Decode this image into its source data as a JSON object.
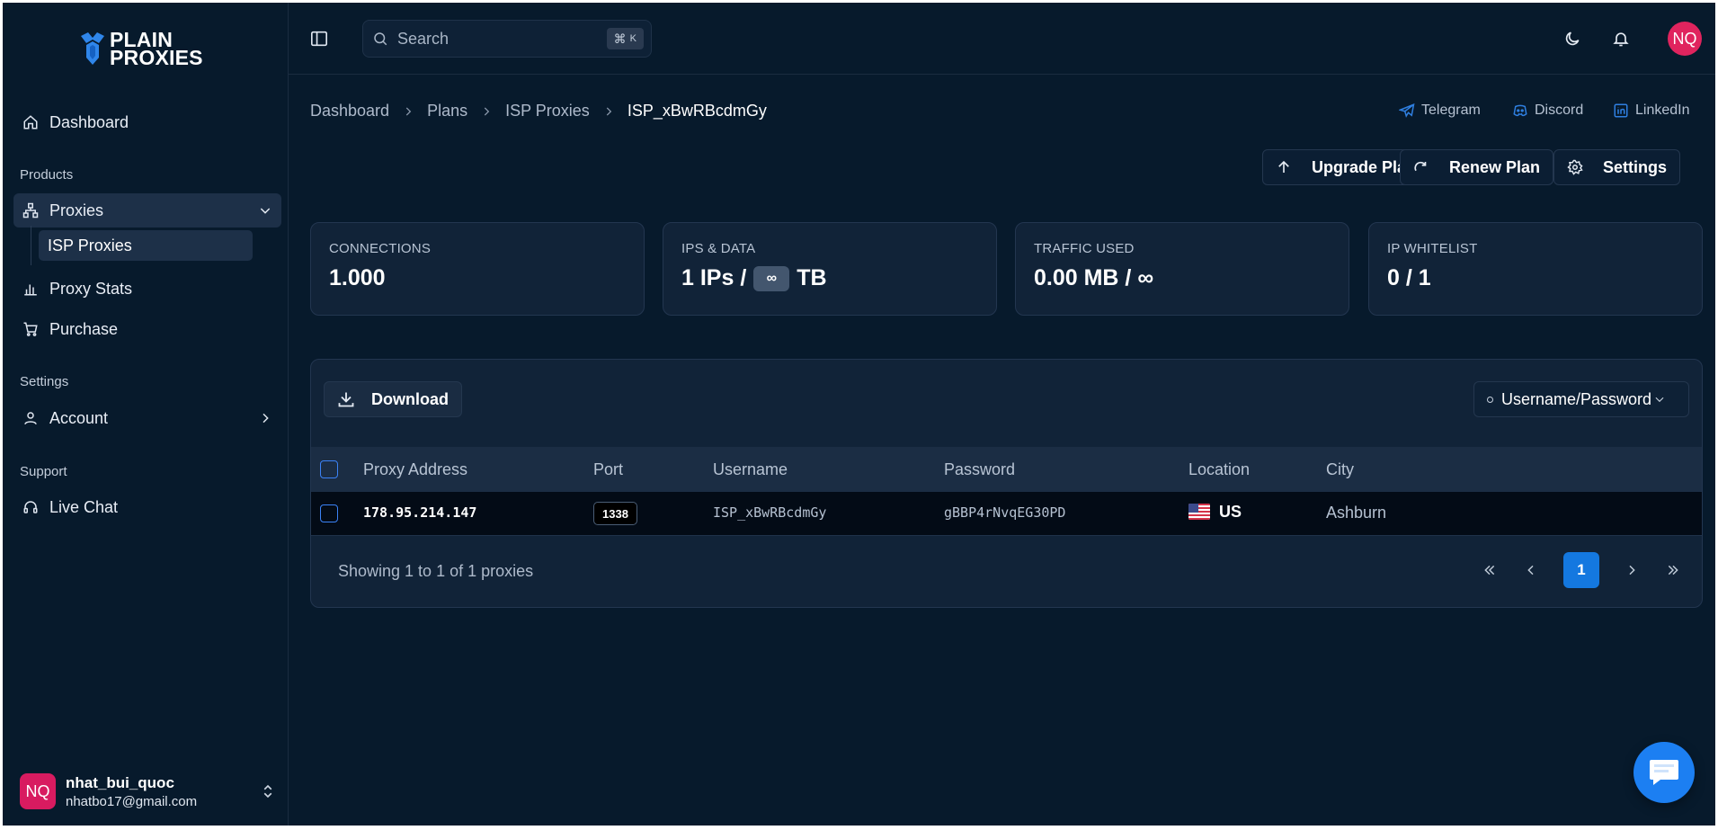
{
  "brand": {
    "logo_line1": "PLAIN",
    "logo_line2": "PROXIES"
  },
  "sidebar": {
    "dashboard": "Dashboard",
    "products_label": "Products",
    "proxies": "Proxies",
    "isp_proxies": "ISP Proxies",
    "proxy_stats": "Proxy Stats",
    "purchase": "Purchase",
    "settings_label": "Settings",
    "account": "Account",
    "support_label": "Support",
    "live_chat": "Live Chat"
  },
  "user": {
    "initials": "NQ",
    "name": "nhat_bui_quoc",
    "email": "nhatbo17@gmail.com"
  },
  "header": {
    "search_placeholder": "Search",
    "shortcut_cmd": "⌘",
    "shortcut_key": "K",
    "avatar_initials": "NQ"
  },
  "breadcrumb": [
    "Dashboard",
    "Plans",
    "ISP Proxies",
    "ISP_xBwRBcdmGy"
  ],
  "social": {
    "telegram": "Telegram",
    "discord": "Discord",
    "linkedin": "LinkedIn"
  },
  "actions": {
    "upgrade": "Upgrade Plan",
    "renew": "Renew Plan",
    "settings": "Settings"
  },
  "stats": {
    "connections": {
      "label": "CONNECTIONS",
      "value": "1.000"
    },
    "ips_data": {
      "label": "IPS & DATA",
      "value_prefix": "1 IPs /",
      "infinity": "∞",
      "value_suffix": "TB"
    },
    "traffic": {
      "label": "TRAFFIC USED",
      "value": "0.00 MB / ∞"
    },
    "whitelist": {
      "label": "IP WHITELIST",
      "value": "0 / 1"
    }
  },
  "table": {
    "download": "Download",
    "auth_mode": "Username/Password",
    "columns": [
      "Proxy Address",
      "Port",
      "Username",
      "Password",
      "Location",
      "City"
    ],
    "rows": [
      {
        "address": "178.95.214.147",
        "port": "1338",
        "username": "ISP_xBwRBcdmGy",
        "password": "gBBP4rNvqEG30PD",
        "location": "US",
        "city": "Ashburn"
      }
    ],
    "showing": "Showing 1 to 1 of 1 proxies",
    "current_page": "1"
  },
  "colors": {
    "background": "#071a2c",
    "card": "#112338",
    "accent": "#1478e0",
    "avatar": "#d81b60"
  }
}
